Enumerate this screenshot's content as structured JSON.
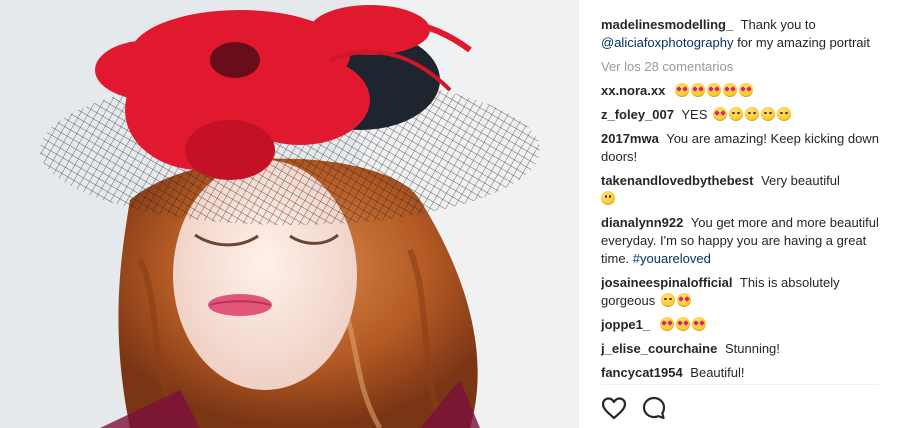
{
  "post": {
    "author": "madelinesmodelling_",
    "caption_pre": "Thank you to",
    "caption_mention": "@aliciafoxphotography",
    "caption_post": "for my amazing portrait",
    "view_comments": "Ver los 28 comentarios"
  },
  "comments": [
    {
      "user": "xx.nora.xx",
      "text": "",
      "emojis": [
        "heart-eyes",
        "heart-eyes",
        "heart-eyes",
        "heart-eyes",
        "heart-eyes"
      ]
    },
    {
      "user": "z_foley_007",
      "text": "YES",
      "emojis": [
        "heart-eyes",
        "kiss",
        "kiss",
        "kiss",
        "kiss"
      ]
    },
    {
      "user": "2017mwa",
      "text": "You are amazing! Keep kicking down doors!",
      "emojis": []
    },
    {
      "user": "takenandlovedbythebest",
      "text": "Very beautiful",
      "emojis": [
        "smile"
      ]
    },
    {
      "user": "dianalynn922",
      "text": "You get more and more beautiful everyday. I'm so happy you are having a great time.",
      "hashtag": "#youareloved",
      "emojis": []
    },
    {
      "user": "josaineespinalofficial",
      "text": "This is absolutely gorgeous",
      "emojis": [
        "kiss",
        "heart-eyes"
      ]
    },
    {
      "user": "joppe1_",
      "text": "",
      "emojis": [
        "heart-eyes",
        "heart-eyes",
        "heart-eyes"
      ]
    },
    {
      "user": "j_elise_courchaine",
      "text": "Stunning!",
      "emojis": []
    },
    {
      "user": "fancycat1954",
      "text": "Beautiful!",
      "emojis": []
    }
  ],
  "actions": {
    "like_icon": "heart-outline-icon",
    "comment_icon": "comment-bubble-icon"
  },
  "colors": {
    "text": "#262626",
    "muted": "#999999",
    "link": "#003569",
    "flower": "#e0192e"
  }
}
